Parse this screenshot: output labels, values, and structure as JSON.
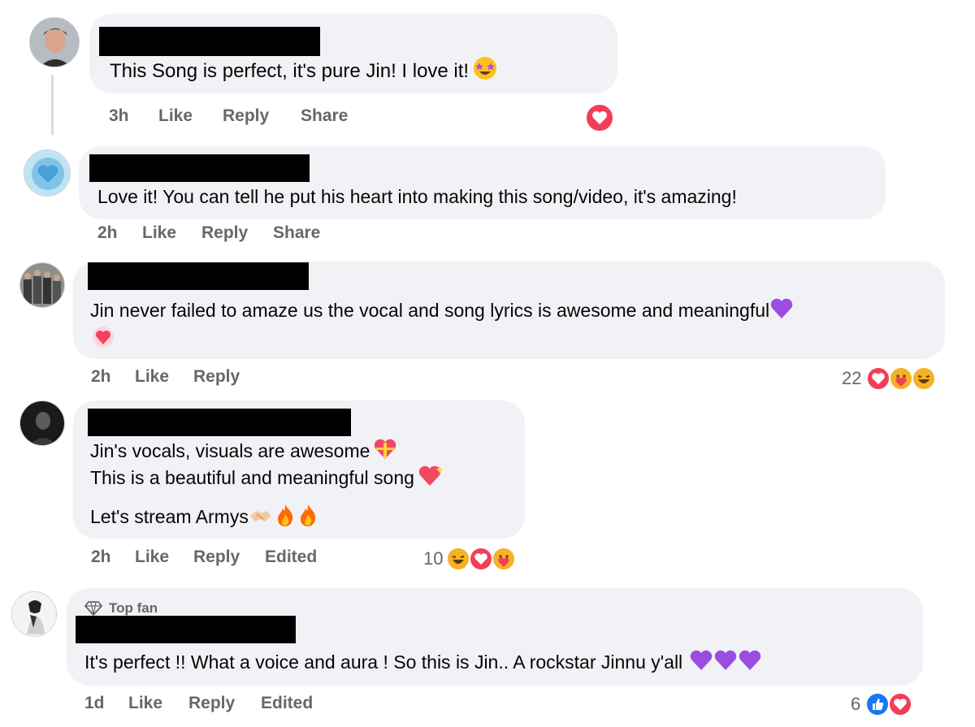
{
  "comments": [
    {
      "text": "This Song is perfect, it's pure Jin! I love it!",
      "time": "3h",
      "actions": [
        "Like",
        "Reply",
        "Share"
      ]
    },
    {
      "text": "Love it! You can tell he put his heart into making this song/video, it's amazing!",
      "time": "2h",
      "actions": [
        "Like",
        "Reply",
        "Share"
      ]
    },
    {
      "text": "Jin never failed to amaze us the vocal and song lyrics is awesome and meaningful",
      "time": "2h",
      "actions": [
        "Like",
        "Reply"
      ],
      "reaction_count": "22"
    },
    {
      "lines": [
        "Jin's vocals, visuals are awesome",
        "This is a beautiful and meaningful song",
        "Let's stream Armys"
      ],
      "time": "2h",
      "actions": [
        "Like",
        "Reply"
      ],
      "edited": "Edited",
      "reaction_count": "10"
    },
    {
      "badge": "Top fan",
      "text": "It's perfect !! What a voice and aura ! So this is Jin.. A rockstar Jinnu y'all",
      "time": "1d",
      "actions": [
        "Like",
        "Reply"
      ],
      "edited": "Edited",
      "reaction_count": "6"
    }
  ],
  "colors": {
    "bubble": "#f0f2f5",
    "meta": "#65676b",
    "love": "#f33e58",
    "like": "#1877f2",
    "purple_heart": "#9b4de0"
  },
  "icons": [
    "star-struck-emoji",
    "purple-heart-emoji",
    "heart-emoji",
    "heart-gift-emoji",
    "sparkling-heart-emoji",
    "handshake-emoji",
    "fire-emoji",
    "love-reaction-icon",
    "care-reaction-icon",
    "haha-reaction-icon",
    "like-reaction-icon",
    "diamond-icon"
  ]
}
